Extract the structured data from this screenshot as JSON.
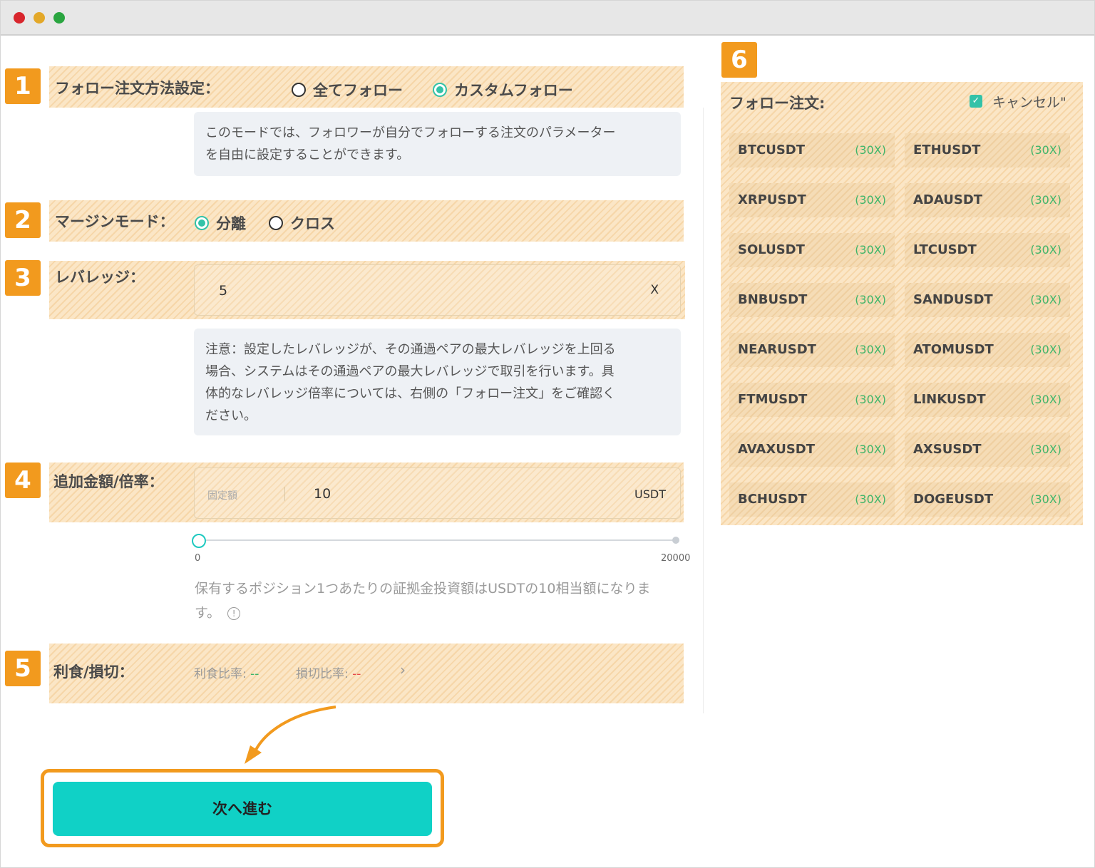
{
  "colors": {
    "accent": "#f29a1e",
    "primary": "#10d1c6",
    "green": "#33c2a8"
  },
  "badges": [
    "1",
    "2",
    "3",
    "4",
    "5",
    "6"
  ],
  "follow_method": {
    "label": "フォロー注文方法設定：",
    "options": [
      "全てフォロー",
      "カスタムフォロー"
    ],
    "selected": "カスタムフォロー",
    "info_line1": "このモードでは、フォロワーが自分でフォローする注文のパラメーター",
    "info_line2": "を自由に設定することができます。"
  },
  "margin_mode": {
    "label": "マージンモード：",
    "options": [
      "分離",
      "クロス"
    ],
    "selected": "分離"
  },
  "leverage": {
    "label": "レバレッジ：",
    "value": "5",
    "unit": "X",
    "note_line1": "注意：設定したレバレッジが、その通過ペアの最大レバレッジを上回る",
    "note_line2": "場合、システムはその通過ペアの最大レバレッジで取引を行います。具",
    "note_line3": "体的なレバレッジ倍率については、右側の「フォロー注文」をご確認く",
    "note_line4": "ださい。"
  },
  "amount": {
    "label": "追加金額/倍率：",
    "mode": "固定額",
    "value": "10",
    "unit": "USDT",
    "slider_min": "0",
    "slider_max": "20000",
    "slider_value": 0,
    "hint_line1": "保有するポジション1つあたりの証拠金投資額はUSDTの10相当額になりま",
    "hint_line2": "す。"
  },
  "tp_sl": {
    "label": "利食/損切：",
    "tp_label": "利食比率:",
    "tp_value": "--",
    "sl_label": "損切比率:",
    "sl_value": "--",
    "chevron": "›"
  },
  "follow_orders": {
    "title": "フォロー注文:",
    "cancel_label": "キャンセル\"",
    "cancel_checked": true,
    "pairs": [
      {
        "symbol": "BTCUSDT",
        "leverage": "(30X)"
      },
      {
        "symbol": "ETHUSDT",
        "leverage": "(30X)"
      },
      {
        "symbol": "XRPUSDT",
        "leverage": "(30X)"
      },
      {
        "symbol": "ADAUSDT",
        "leverage": "(30X)"
      },
      {
        "symbol": "SOLUSDT",
        "leverage": "(30X)"
      },
      {
        "symbol": "LTCUSDT",
        "leverage": "(30X)"
      },
      {
        "symbol": "BNBUSDT",
        "leverage": "(30X)"
      },
      {
        "symbol": "SANDUSDT",
        "leverage": "(30X)"
      },
      {
        "symbol": "NEARUSDT",
        "leverage": "(30X)"
      },
      {
        "symbol": "ATOMUSDT",
        "leverage": "(30X)"
      },
      {
        "symbol": "FTMUSDT",
        "leverage": "(30X)"
      },
      {
        "symbol": "LINKUSDT",
        "leverage": "(30X)"
      },
      {
        "symbol": "AVAXUSDT",
        "leverage": "(30X)"
      },
      {
        "symbol": "AXSUSDT",
        "leverage": "(30X)"
      },
      {
        "symbol": "BCHUSDT",
        "leverage": "(30X)"
      },
      {
        "symbol": "DOGEUSDT",
        "leverage": "(30X)"
      }
    ]
  },
  "next_button": {
    "label": "次へ進む"
  }
}
